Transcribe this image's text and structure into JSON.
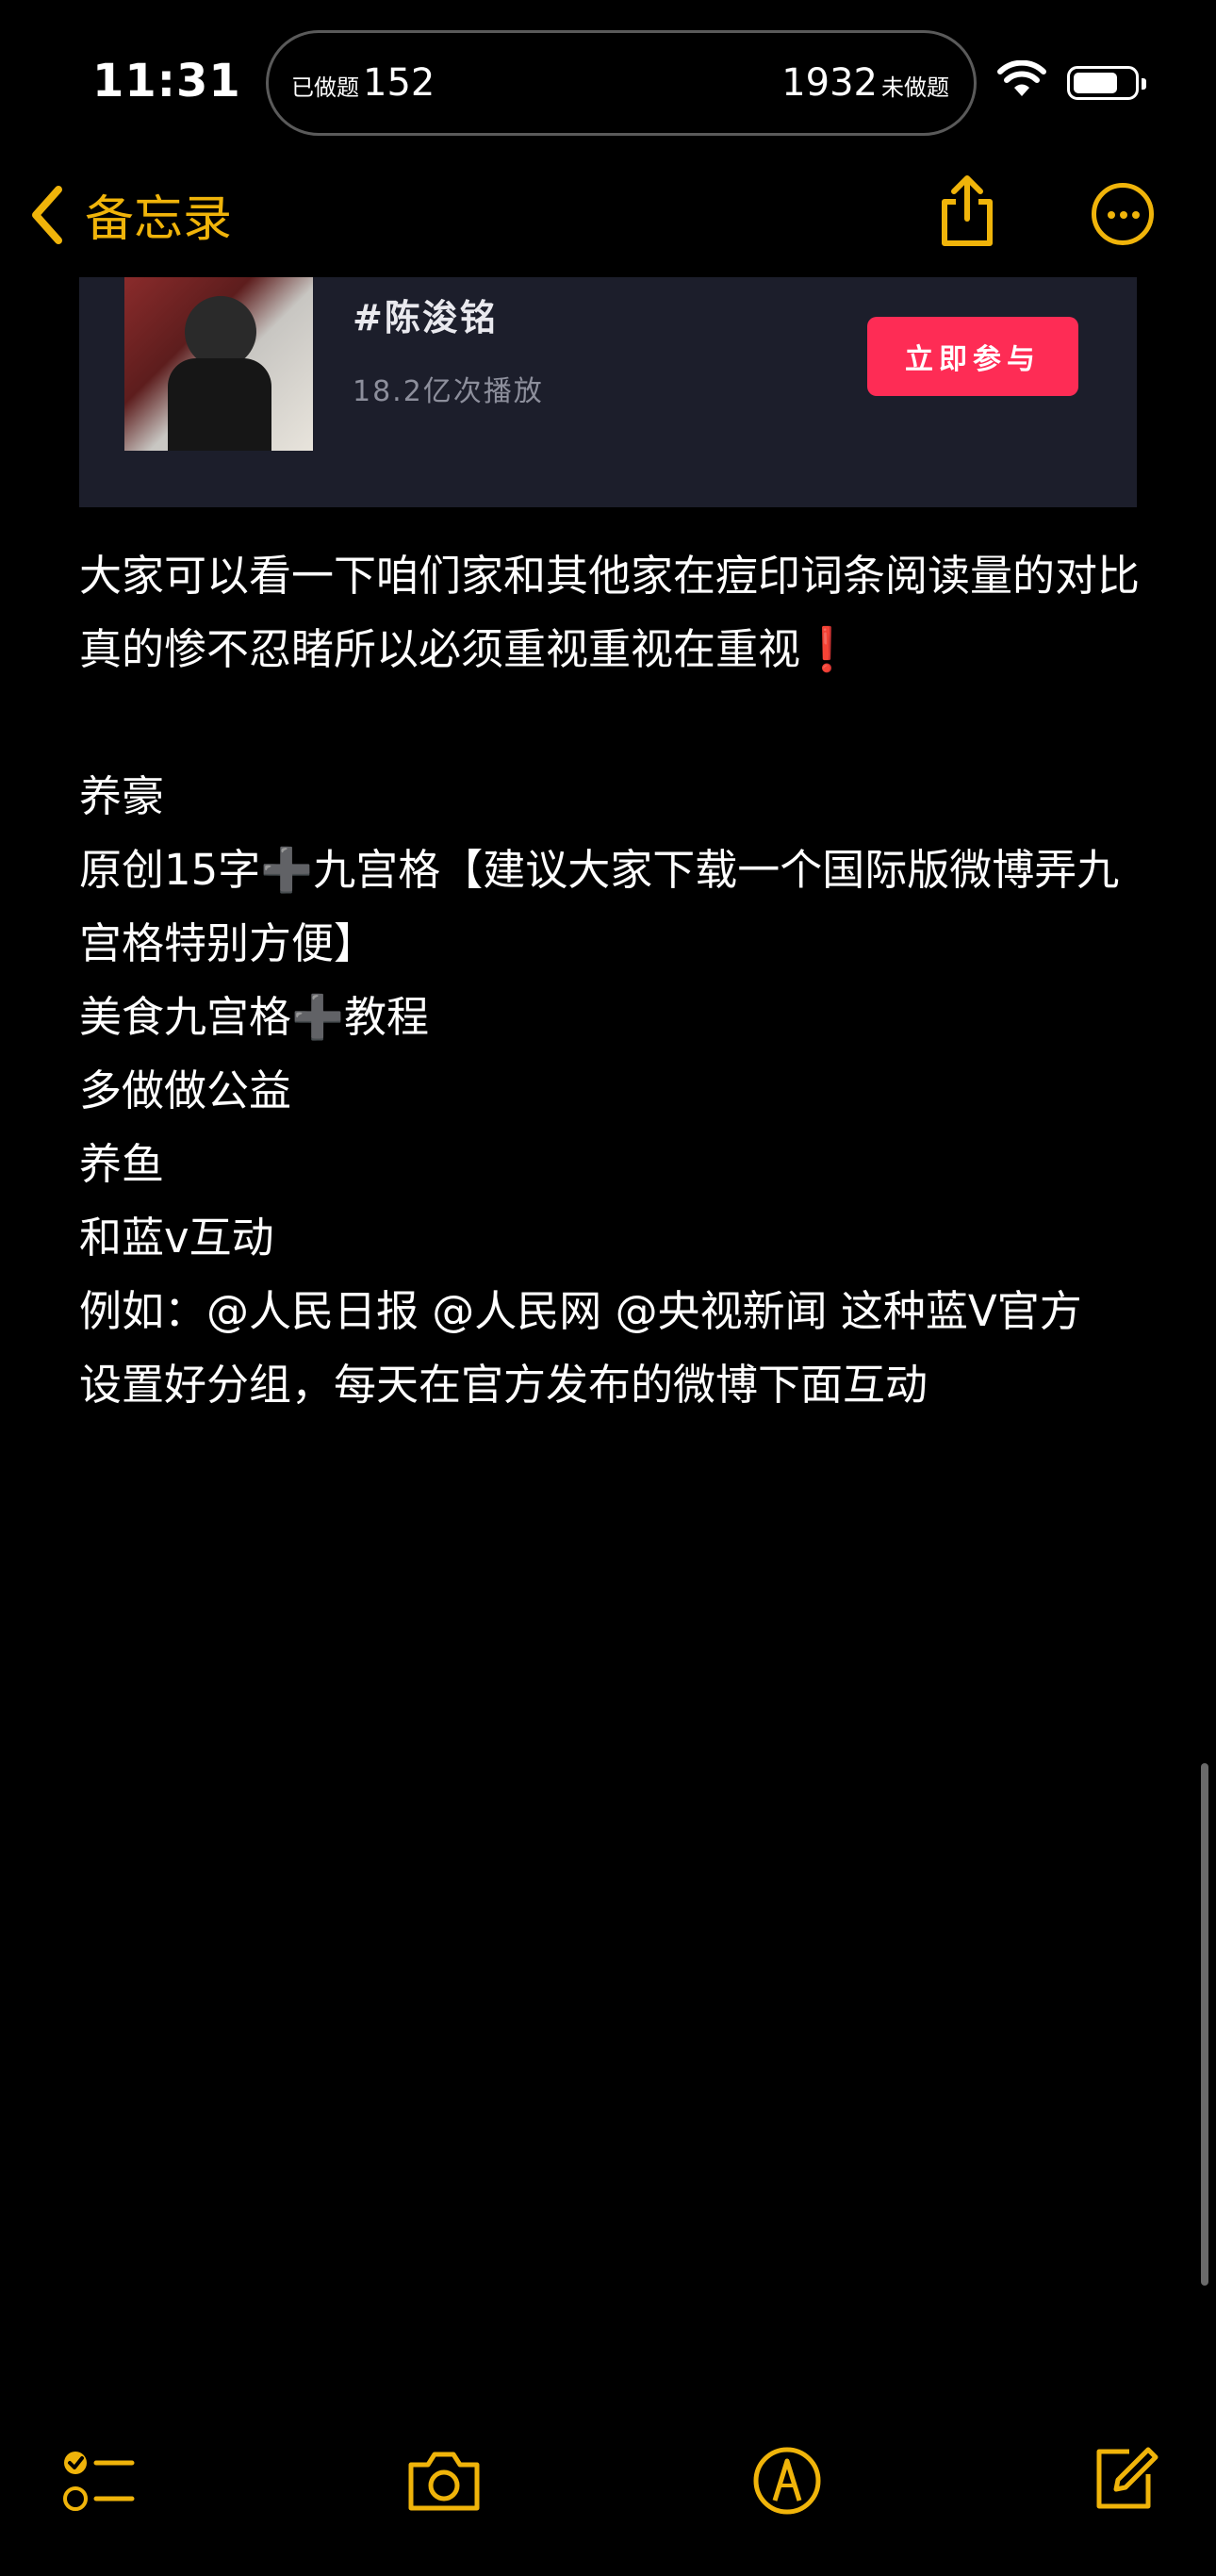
{
  "status_bar": {
    "time": "11:31",
    "done_label": "已做题",
    "done_count": "152",
    "undone_count": "1932",
    "undone_label": "未做题"
  },
  "nav": {
    "back_label": "备忘录"
  },
  "card": {
    "title": "#陈浚铭",
    "subtitle": "18.2亿次播放",
    "button": "立即参与"
  },
  "note": {
    "para1": "大家可以看一下咱们家和其他家在痘印词条阅读量的对比真的惨不忍睹所以必须重视重视在重视",
    "para1_mark": "❗",
    "heading": "养豪",
    "line1a": "原创15字",
    "line1b": "九宫格【建议大家下载一个国际版微博弄九宫格特别方便】",
    "line2a": "美食九宫格",
    "line2b": "教程",
    "line3": "多做做公益",
    "line4": "养鱼",
    "line5": "和蓝v互动",
    "line6": "例如：@人民日报 @人民网 @央视新闻 这种蓝V官方",
    "line7": "设置好分组，每天在官方发布的微博下面互动",
    "plus_glyph": "➕"
  },
  "colors": {
    "accent": "#f0b40a",
    "card_bg": "#1c1e2b",
    "button": "#fe2c55"
  },
  "icons": [
    "wifi-icon",
    "battery-icon",
    "chevron-left-icon",
    "share-icon",
    "more-icon",
    "checklist-icon",
    "camera-icon",
    "markup-icon",
    "compose-icon"
  ]
}
